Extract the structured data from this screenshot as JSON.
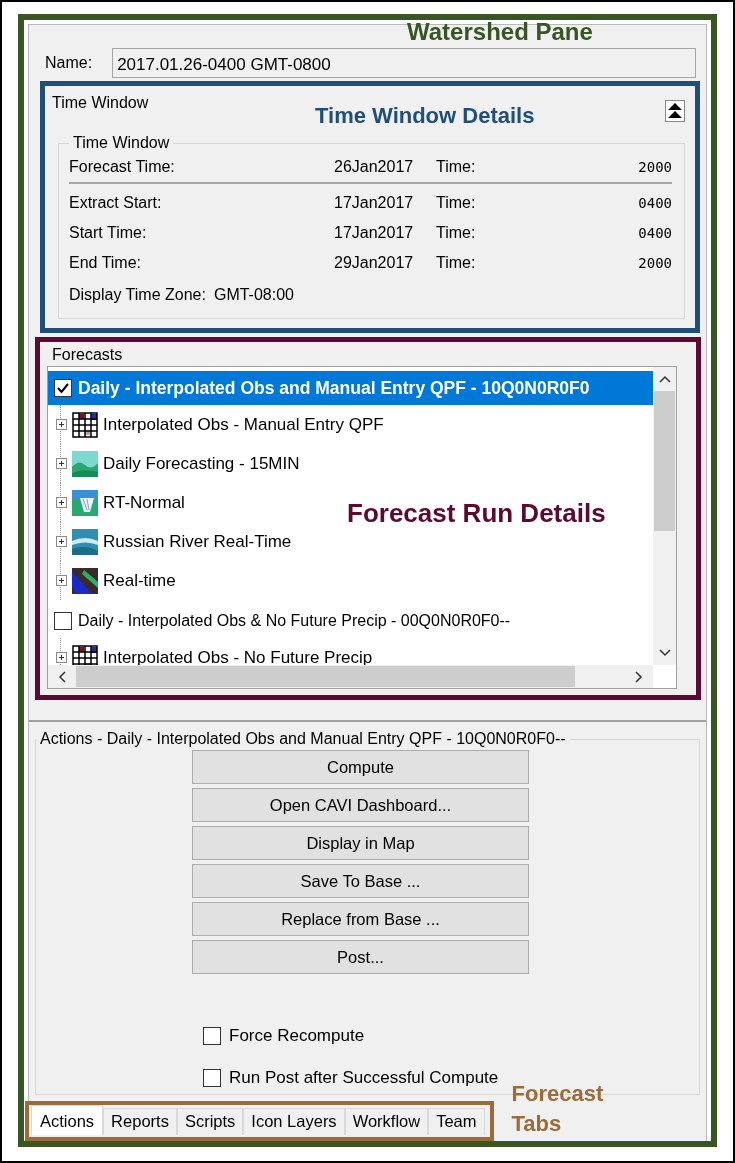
{
  "annotations": [
    {
      "label": "Watershed Pane",
      "color": "#375623"
    },
    {
      "label": "Time Window Details",
      "color": "#1f4e79"
    },
    {
      "label": "Forecast Run Details",
      "color": "#5c0a32"
    },
    {
      "label": "Forecast Tabs",
      "color": "#9c6b3a"
    }
  ],
  "name_field": {
    "label": "Name:",
    "value": "2017.01.26-0400 GMT-0800"
  },
  "time_window": {
    "title": "Time Window",
    "group_title": "Time Window",
    "rows": [
      {
        "kind": "forecast",
        "label": "Forecast Time:",
        "date": "26Jan2017",
        "time_label": "Time:",
        "time": "2000"
      },
      {
        "kind": "range",
        "label": "Extract Start:",
        "date": "17Jan2017",
        "time_label": "Time:",
        "time": "0400"
      },
      {
        "kind": "range",
        "label": "Start Time:",
        "date": "17Jan2017",
        "time_label": "Time:",
        "time": "0400"
      },
      {
        "kind": "range",
        "label": "End Time:",
        "date": "29Jan2017",
        "time_label": "Time:",
        "time": "2000"
      }
    ],
    "time_zone": {
      "label": "Display Time Zone:",
      "value": "GMT-08:00"
    }
  },
  "forecasts": {
    "title": "Forecasts",
    "runs": [
      {
        "label": "Daily - Interpolated Obs and Manual Entry QPF - 10Q0N0R0F0",
        "checked": true,
        "selected": true,
        "children": [
          {
            "label": "Interpolated Obs - Manual Entry QPF",
            "expanded": false
          },
          {
            "label": "Daily Forecasting - 15MIN",
            "expanded": false
          },
          {
            "label": "RT-Normal",
            "expanded": false
          },
          {
            "label": "Russian River Real-Time",
            "expanded": false
          },
          {
            "label": "Real-time",
            "expanded": false
          }
        ]
      },
      {
        "label": "Daily - Interpolated Obs & No Future Precip - 00Q0N0R0F0--",
        "checked": false,
        "selected": false,
        "children": [
          {
            "label": "Interpolated Obs - No Future Precip",
            "expanded": false
          }
        ]
      }
    ]
  },
  "actions": {
    "title": "Actions - Daily - Interpolated Obs and Manual Entry QPF - 10Q0N0R0F0--",
    "buttons": [
      "Compute",
      "Open CAVI Dashboard...",
      "Display in Map",
      "Save To Base ...",
      "Replace from Base ...",
      "Post..."
    ],
    "options": [
      {
        "label": "Force Recompute",
        "checked": false
      },
      {
        "label": "Run Post after Successful Compute",
        "checked": false
      }
    ]
  },
  "tabs": [
    {
      "label": "Actions",
      "selected": true
    },
    {
      "label": "Reports",
      "selected": false
    },
    {
      "label": "Scripts",
      "selected": false
    },
    {
      "label": "Icon Layers",
      "selected": false
    },
    {
      "label": "Workflow",
      "selected": false
    },
    {
      "label": "Team",
      "selected": false
    }
  ]
}
